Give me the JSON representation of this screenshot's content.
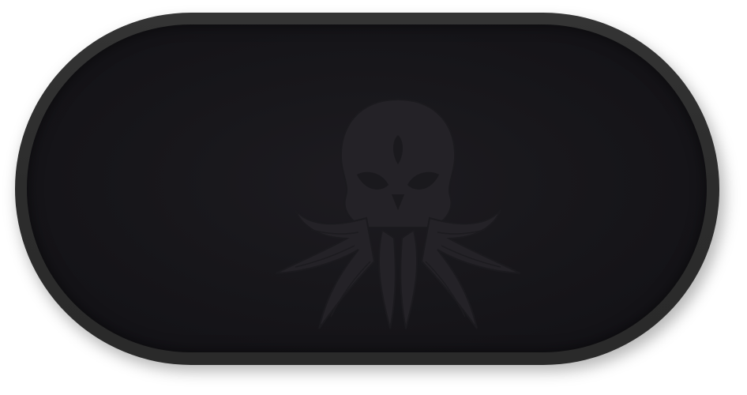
{
  "product": {
    "type": "desk-mat",
    "surface_color": "#18171b",
    "border_color": "#2e2e2e",
    "emblem_color": "#232126",
    "emblem": "skull-octopus-emblem"
  }
}
